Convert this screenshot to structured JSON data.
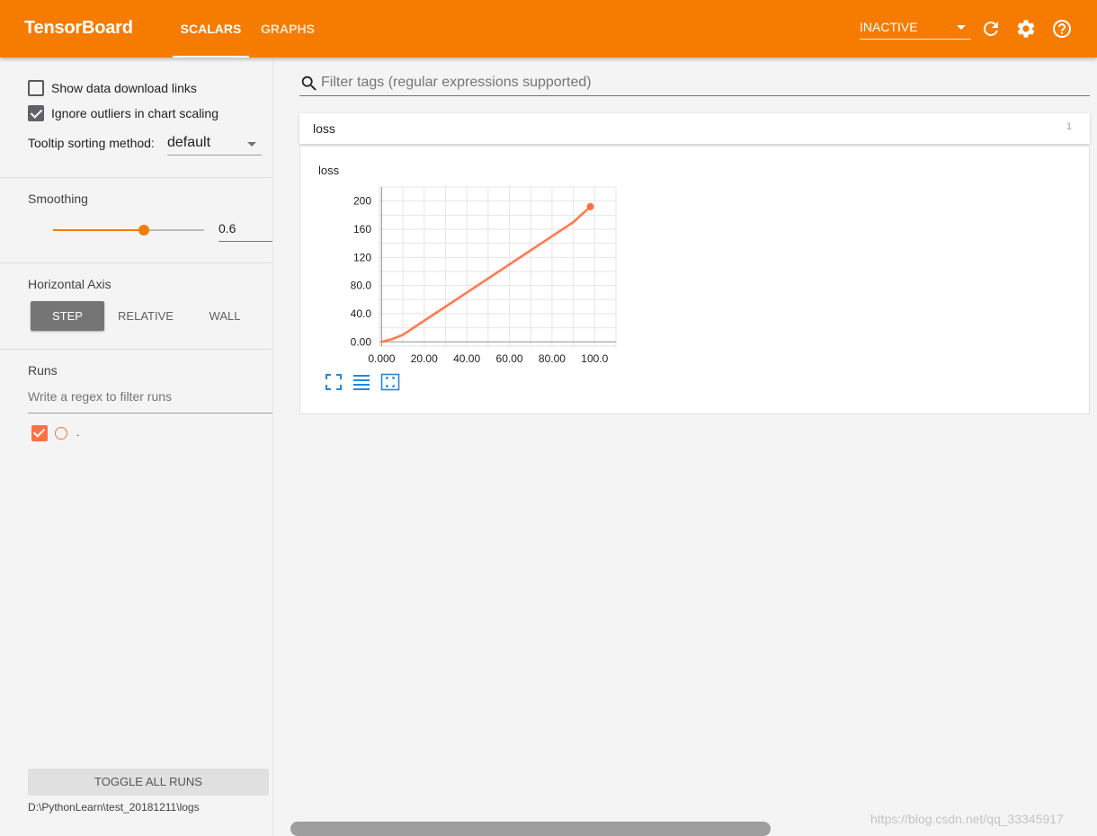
{
  "app": {
    "title": "TensorBoard",
    "accent_color": "#f57c00",
    "tabs": [
      {
        "label": "SCALARS",
        "active": true
      },
      {
        "label": "GRAPHS",
        "active": false
      }
    ],
    "status_select": "INACTIVE",
    "icons": [
      "refresh-icon",
      "settings-icon",
      "help-icon"
    ]
  },
  "sidebar": {
    "show_download_links": {
      "label": "Show data download links",
      "checked": false
    },
    "ignore_outliers": {
      "label": "Ignore outliers in chart scaling",
      "checked": true
    },
    "tooltip_sorting": {
      "label": "Tooltip sorting method:",
      "value": "default"
    },
    "smoothing": {
      "title": "Smoothing",
      "value": "0.6",
      "fraction": 0.6
    },
    "horizontal_axis": {
      "title": "Horizontal Axis",
      "options": [
        "STEP",
        "RELATIVE",
        "WALL"
      ],
      "selected": "STEP"
    },
    "runs": {
      "title": "Runs",
      "filter_placeholder": "Write a regex to filter runs",
      "items": [
        {
          "name": ".",
          "checked": true,
          "color": "#ff7043"
        }
      ]
    },
    "toggle_all_label": "TOGGLE ALL RUNS",
    "log_dir": "D:\\PythonLearn\\test_20181211\\logs"
  },
  "main": {
    "tag_filter_placeholder": "Filter tags (regular expressions supported)",
    "category": {
      "name": "loss",
      "count": "1"
    },
    "chart_icons": [
      "fit-domain-icon",
      "toggle-log-scale-icon",
      "expand-chart-icon"
    ]
  },
  "chart_data": {
    "type": "line",
    "title": "loss",
    "xlabel": "",
    "ylabel": "",
    "x_ticks": [
      "0.000",
      "20.00",
      "40.00",
      "60.00",
      "80.00",
      "100.0"
    ],
    "y_ticks": [
      "0.00",
      "40.0",
      "80.0",
      "120",
      "160",
      "200"
    ],
    "xlim": [
      -1,
      110
    ],
    "ylim": [
      -6,
      220
    ],
    "grid": true,
    "series": [
      {
        "color": "#ff7043",
        "x": [
          0,
          5,
          10,
          20,
          30,
          40,
          50,
          60,
          70,
          80,
          90,
          98
        ],
        "y": [
          0,
          4,
          10,
          30,
          50,
          70,
          90,
          110,
          130,
          150,
          170,
          192
        ]
      }
    ]
  },
  "watermark": "https://blog.csdn.net/qq_33345917"
}
